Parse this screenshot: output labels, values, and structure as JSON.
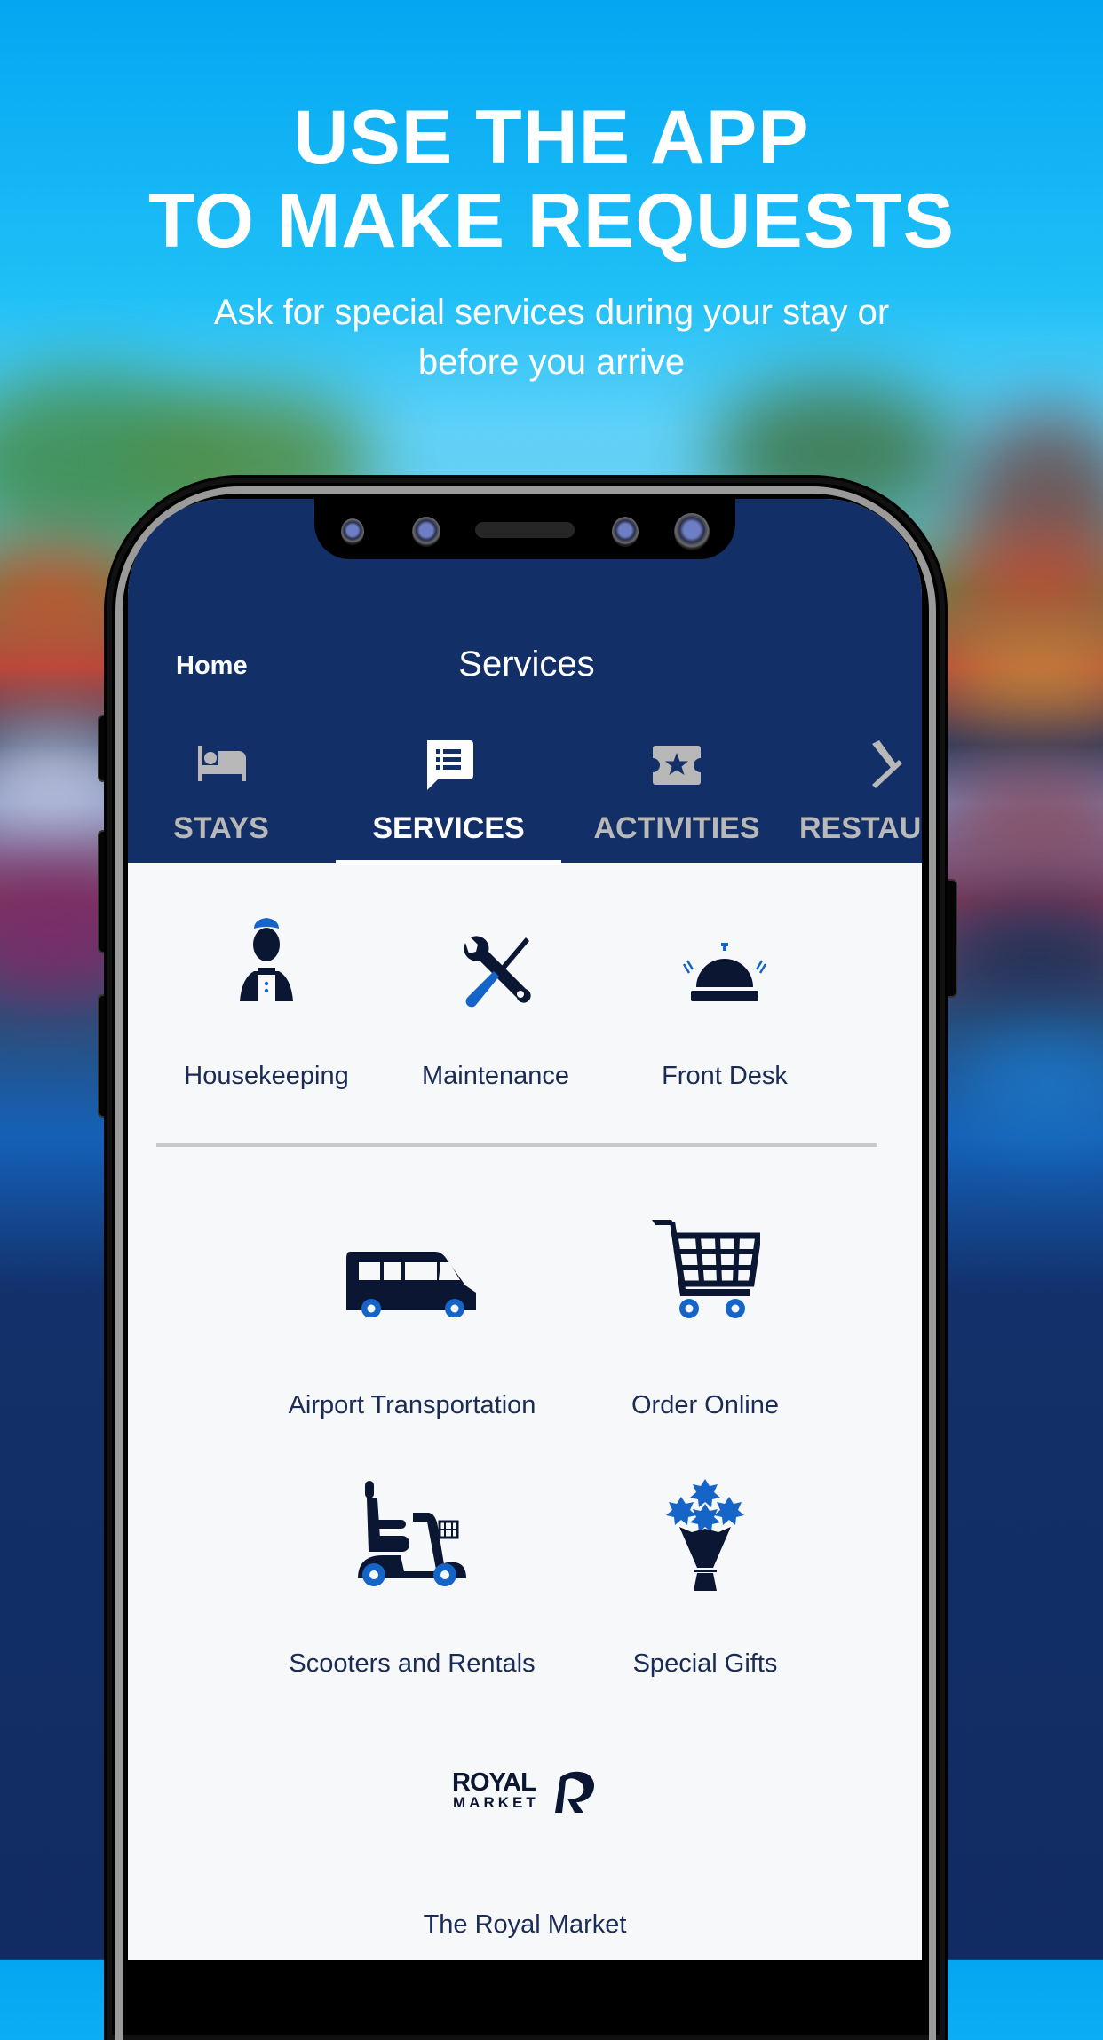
{
  "promo": {
    "headline_line1": "USE THE APP",
    "headline_line2": "TO MAKE REQUESTS",
    "subline_line1": "Ask for special services during your stay or",
    "subline_line2": "before you arrive"
  },
  "app": {
    "header": {
      "back_label": "Home",
      "title": "Services"
    },
    "tabs": [
      {
        "label": "STAYS",
        "icon": "bed-icon",
        "active": false
      },
      {
        "label": "SERVICES",
        "icon": "list-chat-icon",
        "active": true
      },
      {
        "label": "ACTIVITIES",
        "icon": "ticket-star-icon",
        "active": false
      },
      {
        "label": "RESTAU",
        "icon": "utensils-icon",
        "active": false
      }
    ],
    "primary_services": [
      {
        "label": "Housekeeping",
        "icon": "housekeeper-icon"
      },
      {
        "label": "Maintenance",
        "icon": "wrench-screwdriver-icon"
      },
      {
        "label": "Front Desk",
        "icon": "service-bell-icon"
      }
    ],
    "other_services": [
      {
        "label": "Airport Transportation",
        "icon": "van-icon"
      },
      {
        "label": "Order Online",
        "icon": "shopping-cart-icon"
      },
      {
        "label": "Scooters and Rentals",
        "icon": "mobility-scooter-icon"
      },
      {
        "label": "Special Gifts",
        "icon": "flower-bouquet-icon"
      },
      {
        "label": "The Royal Market",
        "icon": "royal-market-logo",
        "logo_line1": "ROYAL",
        "logo_line2": "MARKET"
      }
    ]
  },
  "colors": {
    "header_bg": "#132f68",
    "icon_dark": "#0b1633",
    "icon_accent": "#1565c9",
    "label_text": "#1a2b56",
    "tab_inactive": "#b8b8b8"
  }
}
